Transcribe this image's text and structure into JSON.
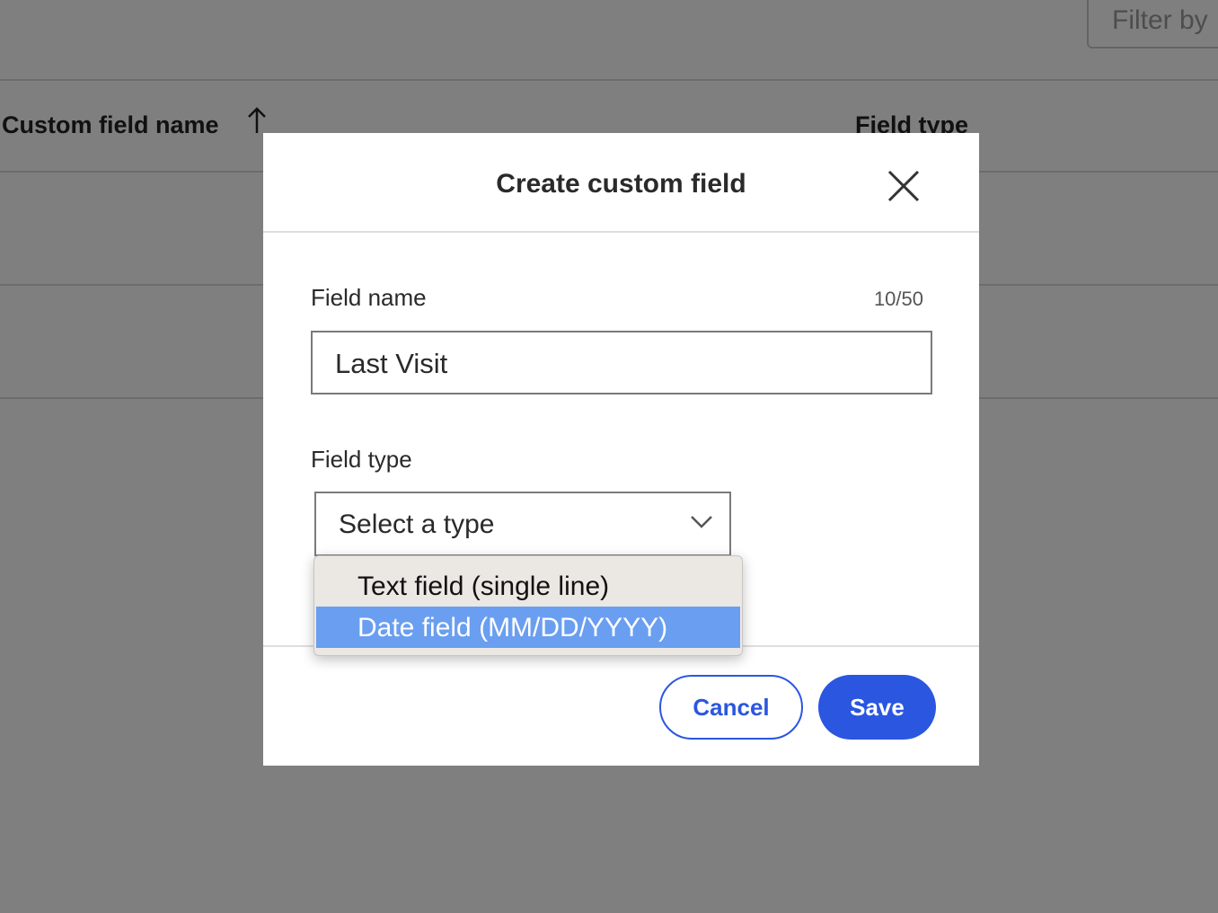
{
  "background": {
    "filter_placeholder": "Filter by",
    "columns": [
      "Custom field name",
      "Field type"
    ]
  },
  "modal": {
    "title": "Create custom field",
    "field_name_label": "Field name",
    "field_name_counter": "10/50",
    "field_name_value": "Last Visit",
    "field_type_label": "Field type",
    "select_placeholder": "Select a type",
    "options": [
      "Text field (single line)",
      "Date field (MM/DD/YYYY)"
    ],
    "highlighted_option": "Date field (MM/DD/YYYY)",
    "cancel_label": "Cancel",
    "save_label": "Save"
  },
  "colors": {
    "primary": "#2a56e0",
    "highlight": "#6a9ef0",
    "overlay": "rgba(0,0,0,0.5)"
  },
  "icons": {
    "close": "close-icon",
    "sort": "arrow-up-icon",
    "select": "chevron-down-icon"
  }
}
